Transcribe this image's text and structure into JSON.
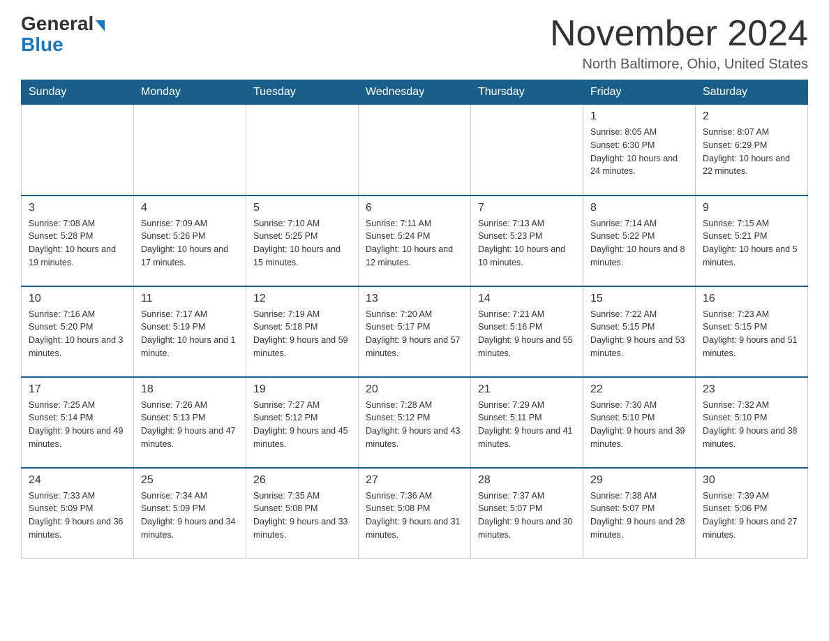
{
  "logo": {
    "general": "General",
    "blue": "Blue",
    "triangle": "▶"
  },
  "header": {
    "month_year": "November 2024",
    "location": "North Baltimore, Ohio, United States"
  },
  "weekdays": [
    "Sunday",
    "Monday",
    "Tuesday",
    "Wednesday",
    "Thursday",
    "Friday",
    "Saturday"
  ],
  "weeks": [
    [
      {
        "day": "",
        "sunrise": "",
        "sunset": "",
        "daylight": ""
      },
      {
        "day": "",
        "sunrise": "",
        "sunset": "",
        "daylight": ""
      },
      {
        "day": "",
        "sunrise": "",
        "sunset": "",
        "daylight": ""
      },
      {
        "day": "",
        "sunrise": "",
        "sunset": "",
        "daylight": ""
      },
      {
        "day": "",
        "sunrise": "",
        "sunset": "",
        "daylight": ""
      },
      {
        "day": "1",
        "sunrise": "Sunrise: 8:05 AM",
        "sunset": "Sunset: 6:30 PM",
        "daylight": "Daylight: 10 hours and 24 minutes."
      },
      {
        "day": "2",
        "sunrise": "Sunrise: 8:07 AM",
        "sunset": "Sunset: 6:29 PM",
        "daylight": "Daylight: 10 hours and 22 minutes."
      }
    ],
    [
      {
        "day": "3",
        "sunrise": "Sunrise: 7:08 AM",
        "sunset": "Sunset: 5:28 PM",
        "daylight": "Daylight: 10 hours and 19 minutes."
      },
      {
        "day": "4",
        "sunrise": "Sunrise: 7:09 AM",
        "sunset": "Sunset: 5:26 PM",
        "daylight": "Daylight: 10 hours and 17 minutes."
      },
      {
        "day": "5",
        "sunrise": "Sunrise: 7:10 AM",
        "sunset": "Sunset: 5:25 PM",
        "daylight": "Daylight: 10 hours and 15 minutes."
      },
      {
        "day": "6",
        "sunrise": "Sunrise: 7:11 AM",
        "sunset": "Sunset: 5:24 PM",
        "daylight": "Daylight: 10 hours and 12 minutes."
      },
      {
        "day": "7",
        "sunrise": "Sunrise: 7:13 AM",
        "sunset": "Sunset: 5:23 PM",
        "daylight": "Daylight: 10 hours and 10 minutes."
      },
      {
        "day": "8",
        "sunrise": "Sunrise: 7:14 AM",
        "sunset": "Sunset: 5:22 PM",
        "daylight": "Daylight: 10 hours and 8 minutes."
      },
      {
        "day": "9",
        "sunrise": "Sunrise: 7:15 AM",
        "sunset": "Sunset: 5:21 PM",
        "daylight": "Daylight: 10 hours and 5 minutes."
      }
    ],
    [
      {
        "day": "10",
        "sunrise": "Sunrise: 7:16 AM",
        "sunset": "Sunset: 5:20 PM",
        "daylight": "Daylight: 10 hours and 3 minutes."
      },
      {
        "day": "11",
        "sunrise": "Sunrise: 7:17 AM",
        "sunset": "Sunset: 5:19 PM",
        "daylight": "Daylight: 10 hours and 1 minute."
      },
      {
        "day": "12",
        "sunrise": "Sunrise: 7:19 AM",
        "sunset": "Sunset: 5:18 PM",
        "daylight": "Daylight: 9 hours and 59 minutes."
      },
      {
        "day": "13",
        "sunrise": "Sunrise: 7:20 AM",
        "sunset": "Sunset: 5:17 PM",
        "daylight": "Daylight: 9 hours and 57 minutes."
      },
      {
        "day": "14",
        "sunrise": "Sunrise: 7:21 AM",
        "sunset": "Sunset: 5:16 PM",
        "daylight": "Daylight: 9 hours and 55 minutes."
      },
      {
        "day": "15",
        "sunrise": "Sunrise: 7:22 AM",
        "sunset": "Sunset: 5:15 PM",
        "daylight": "Daylight: 9 hours and 53 minutes."
      },
      {
        "day": "16",
        "sunrise": "Sunrise: 7:23 AM",
        "sunset": "Sunset: 5:15 PM",
        "daylight": "Daylight: 9 hours and 51 minutes."
      }
    ],
    [
      {
        "day": "17",
        "sunrise": "Sunrise: 7:25 AM",
        "sunset": "Sunset: 5:14 PM",
        "daylight": "Daylight: 9 hours and 49 minutes."
      },
      {
        "day": "18",
        "sunrise": "Sunrise: 7:26 AM",
        "sunset": "Sunset: 5:13 PM",
        "daylight": "Daylight: 9 hours and 47 minutes."
      },
      {
        "day": "19",
        "sunrise": "Sunrise: 7:27 AM",
        "sunset": "Sunset: 5:12 PM",
        "daylight": "Daylight: 9 hours and 45 minutes."
      },
      {
        "day": "20",
        "sunrise": "Sunrise: 7:28 AM",
        "sunset": "Sunset: 5:12 PM",
        "daylight": "Daylight: 9 hours and 43 minutes."
      },
      {
        "day": "21",
        "sunrise": "Sunrise: 7:29 AM",
        "sunset": "Sunset: 5:11 PM",
        "daylight": "Daylight: 9 hours and 41 minutes."
      },
      {
        "day": "22",
        "sunrise": "Sunrise: 7:30 AM",
        "sunset": "Sunset: 5:10 PM",
        "daylight": "Daylight: 9 hours and 39 minutes."
      },
      {
        "day": "23",
        "sunrise": "Sunrise: 7:32 AM",
        "sunset": "Sunset: 5:10 PM",
        "daylight": "Daylight: 9 hours and 38 minutes."
      }
    ],
    [
      {
        "day": "24",
        "sunrise": "Sunrise: 7:33 AM",
        "sunset": "Sunset: 5:09 PM",
        "daylight": "Daylight: 9 hours and 36 minutes."
      },
      {
        "day": "25",
        "sunrise": "Sunrise: 7:34 AM",
        "sunset": "Sunset: 5:09 PM",
        "daylight": "Daylight: 9 hours and 34 minutes."
      },
      {
        "day": "26",
        "sunrise": "Sunrise: 7:35 AM",
        "sunset": "Sunset: 5:08 PM",
        "daylight": "Daylight: 9 hours and 33 minutes."
      },
      {
        "day": "27",
        "sunrise": "Sunrise: 7:36 AM",
        "sunset": "Sunset: 5:08 PM",
        "daylight": "Daylight: 9 hours and 31 minutes."
      },
      {
        "day": "28",
        "sunrise": "Sunrise: 7:37 AM",
        "sunset": "Sunset: 5:07 PM",
        "daylight": "Daylight: 9 hours and 30 minutes."
      },
      {
        "day": "29",
        "sunrise": "Sunrise: 7:38 AM",
        "sunset": "Sunset: 5:07 PM",
        "daylight": "Daylight: 9 hours and 28 minutes."
      },
      {
        "day": "30",
        "sunrise": "Sunrise: 7:39 AM",
        "sunset": "Sunset: 5:06 PM",
        "daylight": "Daylight: 9 hours and 27 minutes."
      }
    ]
  ]
}
